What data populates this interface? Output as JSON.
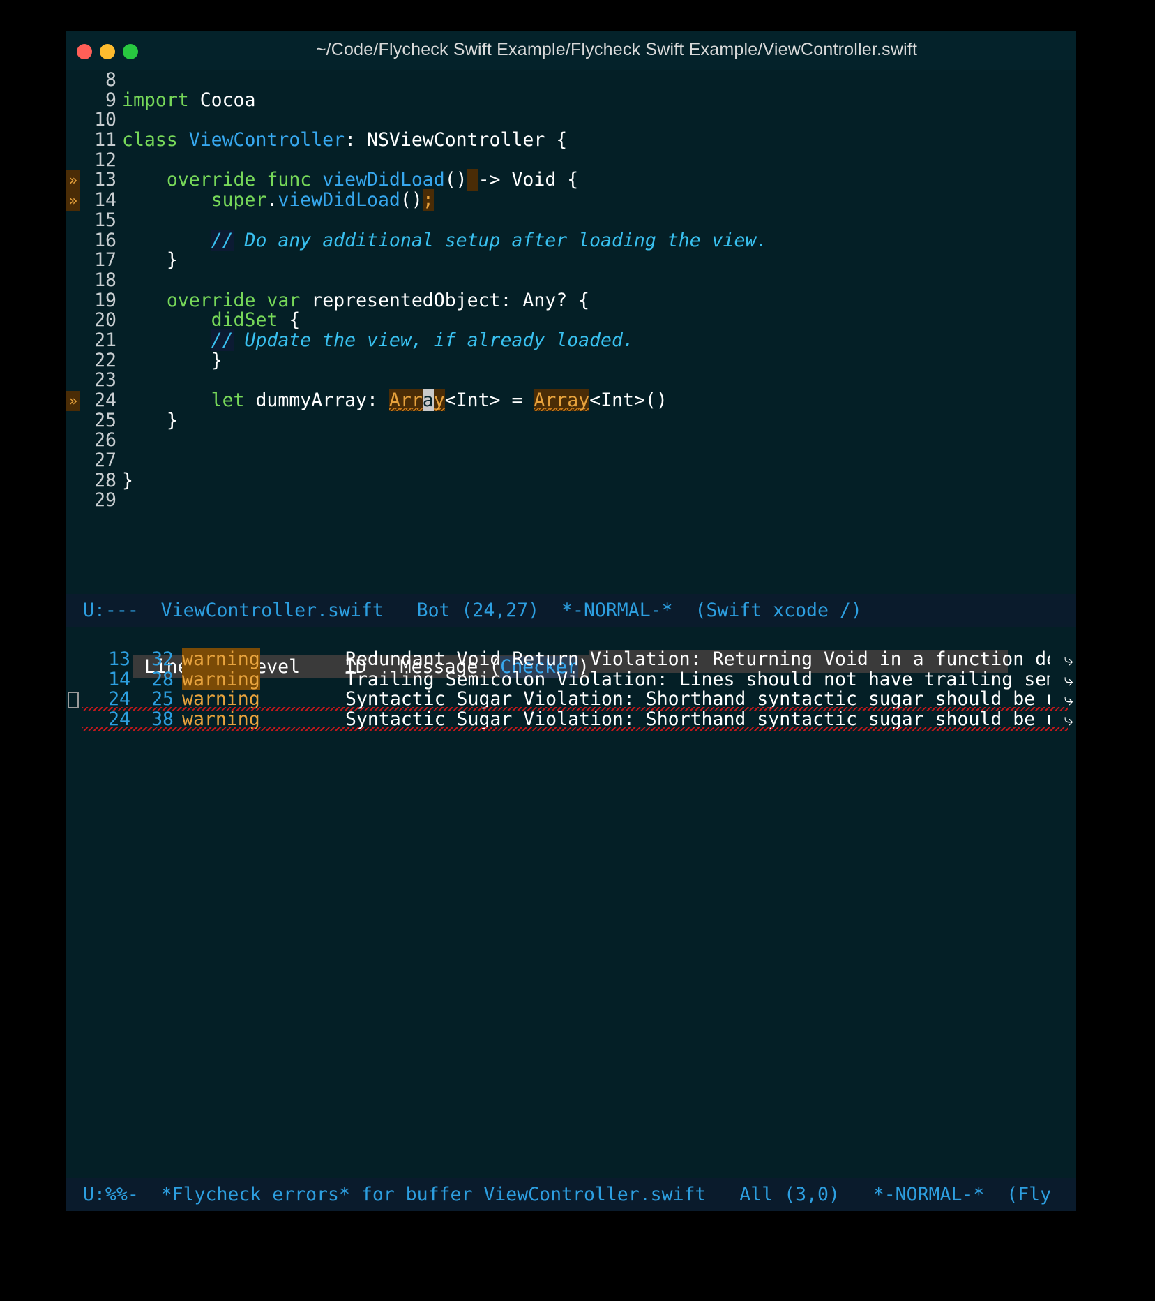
{
  "window": {
    "title": "~/Code/Flycheck Swift Example/Flycheck Swift Example/ViewController.swift",
    "traffic": {
      "close": "close",
      "minimize": "minimize",
      "maximize": "maximize"
    }
  },
  "code": {
    "lines": [
      {
        "num": "8",
        "fringe": "",
        "tokens": []
      },
      {
        "num": "9",
        "fringe": "",
        "tokens": [
          {
            "t": "import ",
            "c": "kw"
          },
          {
            "t": "Cocoa",
            "c": "plain"
          }
        ]
      },
      {
        "num": "10",
        "fringe": "",
        "tokens": []
      },
      {
        "num": "11",
        "fringe": "",
        "tokens": [
          {
            "t": "class ",
            "c": "kw"
          },
          {
            "t": "ViewController",
            "c": "typ"
          },
          {
            "t": ": NSViewController {",
            "c": "plain"
          }
        ]
      },
      {
        "num": "12",
        "fringe": "",
        "tokens": []
      },
      {
        "num": "13",
        "fringe": "»",
        "tokens": [
          {
            "t": "    ",
            "c": "plain"
          },
          {
            "t": "override func ",
            "c": "kw"
          },
          {
            "t": "viewDidLoad",
            "c": "typ"
          },
          {
            "t": "()",
            "c": "plain"
          },
          {
            "t": " ",
            "c": "warnbox"
          },
          {
            "t": "-> Void {",
            "c": "plain"
          }
        ]
      },
      {
        "num": "14",
        "fringe": "»",
        "tokens": [
          {
            "t": "        ",
            "c": "plain"
          },
          {
            "t": "super",
            "c": "kw"
          },
          {
            "t": ".",
            "c": "plain"
          },
          {
            "t": "viewDidLoad",
            "c": "typ"
          },
          {
            "t": "()",
            "c": "plain"
          },
          {
            "t": ";",
            "c": "warnbox"
          }
        ]
      },
      {
        "num": "15",
        "fringe": "",
        "tokens": []
      },
      {
        "num": "16",
        "fringe": "",
        "tokens": [
          {
            "t": "        ",
            "c": "plain"
          },
          {
            "t": "//",
            "c": "cmtmark"
          },
          {
            "t": " Do any additional setup after loading the view.",
            "c": "cmt"
          }
        ]
      },
      {
        "num": "17",
        "fringe": "",
        "tokens": [
          {
            "t": "    }",
            "c": "plain"
          }
        ]
      },
      {
        "num": "18",
        "fringe": "",
        "tokens": []
      },
      {
        "num": "19",
        "fringe": "",
        "tokens": [
          {
            "t": "    ",
            "c": "plain"
          },
          {
            "t": "override var ",
            "c": "kw"
          },
          {
            "t": "representedObject: Any? {",
            "c": "plain"
          }
        ]
      },
      {
        "num": "20",
        "fringe": "",
        "tokens": [
          {
            "t": "        ",
            "c": "plain"
          },
          {
            "t": "didSet",
            "c": "kw"
          },
          {
            "t": " {",
            "c": "plain"
          }
        ]
      },
      {
        "num": "21",
        "fringe": "",
        "tokens": [
          {
            "t": "        ",
            "c": "plain"
          },
          {
            "t": "//",
            "c": "cmtmark"
          },
          {
            "t": " Update the view, if already loaded.",
            "c": "cmt"
          }
        ]
      },
      {
        "num": "22",
        "fringe": "",
        "tokens": [
          {
            "t": "        }",
            "c": "plain"
          }
        ]
      },
      {
        "num": "23",
        "fringe": "",
        "tokens": []
      },
      {
        "num": "24",
        "fringe": "»",
        "tokens": [
          {
            "t": "        ",
            "c": "plain"
          },
          {
            "t": "let ",
            "c": "kw"
          },
          {
            "t": "dummyArray: ",
            "c": "plain"
          },
          {
            "t": "Arr",
            "c": "warnbox squig-orange"
          },
          {
            "t": "a",
            "c": "cursor-blk"
          },
          {
            "t": "y",
            "c": "warnbox squig-orange"
          },
          {
            "t": "<Int> = ",
            "c": "plain"
          },
          {
            "t": "Array",
            "c": "warnbox squig-orange"
          },
          {
            "t": "<Int>()",
            "c": "plain"
          }
        ]
      },
      {
        "num": "25",
        "fringe": "",
        "tokens": [
          {
            "t": "    }",
            "c": "plain"
          }
        ]
      },
      {
        "num": "26",
        "fringe": "",
        "tokens": []
      },
      {
        "num": "27",
        "fringe": "",
        "tokens": []
      },
      {
        "num": "28",
        "fringe": "",
        "tokens": [
          {
            "t": "}",
            "c": "plain"
          }
        ]
      },
      {
        "num": "29",
        "fringe": "",
        "tokens": []
      }
    ]
  },
  "modeline_top": {
    "status": "U:---",
    "buffer": "ViewController.swift",
    "position": "Bot (24,27)",
    "evil_state": "*-NORMAL-*",
    "major_mode": "(Swift xcode /)",
    "full": "U:---  ViewController.swift   Bot (24,27)  *-NORMAL-*  (Swift xcode /)"
  },
  "flycheck": {
    "header": {
      "line": "Line",
      "col": "Col",
      "level": "Level",
      "id": "ID",
      "message_prefix": "Message (",
      "checker": "Checker",
      "message_suffix": ")",
      "full_left": " Line Col Level    ID   ",
      "full_msg_prefix": "Message (",
      "full_msg_suffix": ")"
    },
    "rows": [
      {
        "fringe": "",
        "line": "13",
        "col": "32",
        "level": "warning",
        "level_boxed": true,
        "id": "",
        "message": "Redundant Void Return Violation: Returning Void in a function declaration is redundant. (redundant_void_return)",
        "truncated": true,
        "arrow": "⤷",
        "underlined": false
      },
      {
        "fringe": "",
        "line": "14",
        "col": "28",
        "level": "warning",
        "level_boxed": true,
        "id": "",
        "message": "Trailing Semicolon Violation: Lines should not have trailing semicolons. (trailing_semicolon)",
        "truncated": true,
        "arrow": "⤷",
        "underlined": false
      },
      {
        "fringe": "cursor-box",
        "line": "24",
        "col": "25",
        "level": "warning",
        "level_boxed": false,
        "id": "",
        "message": "Syntactic Sugar Violation: Shorthand syntactic sugar should be used, i.e. [Int] instead of Array<Int>. (syntactic_sugar)",
        "truncated": true,
        "arrow": "⤷",
        "underlined": true
      },
      {
        "fringe": "",
        "line": "24",
        "col": "38",
        "level": "warning",
        "level_boxed": false,
        "id": "",
        "message": "Syntactic Sugar Violation: Shorthand syntactic sugar should be used, i.e. [Int] instead of Array<Int>. (syntactic_sugar)",
        "truncated": true,
        "arrow": "⤷",
        "underlined": true
      }
    ]
  },
  "modeline_bottom": {
    "status": "U:%%-",
    "buffer": "*Flycheck errors* for buffer ViewController.swift",
    "position": "All (3,0)",
    "evil_state": "*-NORMAL-*",
    "major_mode": "(Fly",
    "full": "U:%%-  *Flycheck errors* for buffer ViewController.swift   All (3,0)   *-NORMAL-*  (Fly"
  },
  "colors": {
    "background": "#041f26",
    "desktop": "#000000",
    "modeline_bg": "#0a1b2c",
    "modeline_fg": "#2d9fe0",
    "keyword": "#77d859",
    "type": "#37a8ef",
    "comment": "#39c0ef",
    "warning": "#e8a33d",
    "warning_bg": "#4a2c06",
    "error_underline": "#c0181c",
    "header_bg": "#3a3a3a"
  }
}
